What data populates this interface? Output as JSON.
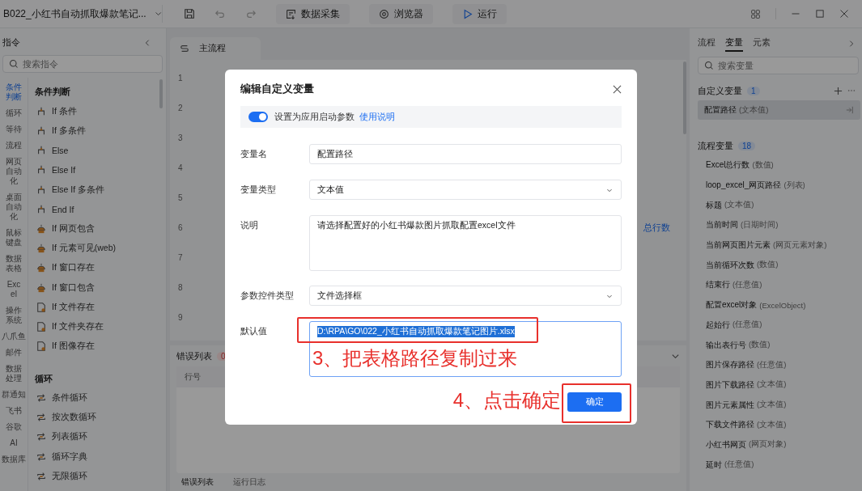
{
  "title_bar": {
    "project_name": "B022_小红书自动抓取爆款笔记...",
    "tools": [
      {
        "label": "数据采集",
        "kind": "collect"
      },
      {
        "label": "浏览器",
        "kind": "browser"
      },
      {
        "label": "运行",
        "kind": "run"
      }
    ]
  },
  "left_panel": {
    "title": "指令",
    "search_placeholder": "搜索指令",
    "categories": [
      {
        "label": "条件判断",
        "selected": true
      },
      {
        "label": "循环",
        "selected": false
      },
      {
        "label": "等待",
        "selected": false
      },
      {
        "label": "流程",
        "selected": false
      },
      {
        "label": "网页自动化",
        "selected": false
      },
      {
        "label": "桌面自动化",
        "selected": false
      },
      {
        "label": "鼠标键盘",
        "selected": false
      },
      {
        "label": "数据表格",
        "selected": false
      },
      {
        "label": "Excel",
        "selected": false
      },
      {
        "label": "操作系统",
        "selected": false
      },
      {
        "label": "八爪鱼",
        "selected": false
      },
      {
        "label": "邮件",
        "selected": false
      },
      {
        "label": "数据处理",
        "selected": false
      },
      {
        "label": "群通知",
        "selected": false
      },
      {
        "label": "飞书",
        "selected": false
      },
      {
        "label": "谷歌",
        "selected": false
      },
      {
        "label": "AI",
        "selected": false
      },
      {
        "label": "数据库",
        "selected": false
      }
    ],
    "groups": [
      {
        "title": "条件判断",
        "items": [
          {
            "label": "If 条件",
            "kind": "branch"
          },
          {
            "label": "If 多条件",
            "kind": "branch"
          },
          {
            "label": "Else",
            "kind": "branch"
          },
          {
            "label": "Else If",
            "kind": "branch"
          },
          {
            "label": "Else If 多条件",
            "kind": "branch"
          },
          {
            "label": "End If",
            "kind": "branch"
          },
          {
            "label": "If 网页包含",
            "kind": "probe"
          },
          {
            "label": "If 元素可见(web)",
            "kind": "probe"
          },
          {
            "label": "If 窗口存在",
            "kind": "probe"
          },
          {
            "label": "If 窗口包含",
            "kind": "probe"
          },
          {
            "label": "If 文件存在",
            "kind": "file"
          },
          {
            "label": "If 文件夹存在",
            "kind": "file"
          },
          {
            "label": "If 图像存在",
            "kind": "file"
          }
        ]
      },
      {
        "title": "循环",
        "items": [
          {
            "label": "条件循环",
            "kind": "loop"
          },
          {
            "label": "按次数循环",
            "kind": "loop"
          },
          {
            "label": "列表循环",
            "kind": "loop"
          },
          {
            "label": "循环字典",
            "kind": "loop"
          },
          {
            "label": "无限循环",
            "kind": "loop"
          }
        ]
      }
    ]
  },
  "editor": {
    "tab": "主流程",
    "line_numbers": [
      "1",
      "2",
      "3",
      "4",
      "5",
      "6",
      "7",
      "8",
      "9"
    ],
    "partial_text": "总行数"
  },
  "bottom_panel": {
    "title": "错误列表",
    "count": "0",
    "columns": [
      "行号"
    ],
    "tabs": [
      {
        "label": "错误列表",
        "selected": true
      },
      {
        "label": "运行日志",
        "selected": false
      }
    ]
  },
  "right_panel": {
    "tabs": [
      {
        "label": "流程",
        "selected": false
      },
      {
        "label": "变量",
        "selected": true
      },
      {
        "label": "元素",
        "selected": false
      }
    ],
    "search_placeholder": "搜索变量",
    "custom_vars": {
      "title": "自定义变量",
      "count": "1",
      "items": [
        {
          "name": "配置路径",
          "type": "(文本值)",
          "selected": true
        }
      ]
    },
    "flow_vars": {
      "title": "流程变量",
      "count": "18",
      "items": [
        {
          "name": "Excel总行数",
          "type": "(数值)"
        },
        {
          "name": "loop_excel_网页路径",
          "type": "(列表)"
        },
        {
          "name": "标题",
          "type": "(文本值)"
        },
        {
          "name": "当前时间",
          "type": "(日期时间)"
        },
        {
          "name": "当前网页图片元素",
          "type": "(网页元素对象)"
        },
        {
          "name": "当前循环次数",
          "type": "(数值)"
        },
        {
          "name": "结束行",
          "type": "(任意值)"
        },
        {
          "name": "配置excel对象",
          "type": "(ExcelObject)"
        },
        {
          "name": "起始行",
          "type": "(任意值)"
        },
        {
          "name": "输出表行号",
          "type": "(数值)"
        },
        {
          "name": "图片保存路径",
          "type": "(任意值)"
        },
        {
          "name": "图片下载路径",
          "type": "(文本值)"
        },
        {
          "name": "图片元素属性",
          "type": "(文本值)"
        },
        {
          "name": "下载文件路径",
          "type": "(文本值)"
        },
        {
          "name": "小红书网页",
          "type": "(网页对象)"
        },
        {
          "name": "延时",
          "type": "(任意值)"
        }
      ]
    }
  },
  "dialog": {
    "title": "编辑自定义变量",
    "toggle": {
      "label": "设置为应用启动参数",
      "link": "使用说明",
      "on": true
    },
    "fields": [
      {
        "label": "变量名",
        "kind": "input",
        "value": "配置路径"
      },
      {
        "label": "变量类型",
        "kind": "select",
        "value": "文本值"
      },
      {
        "label": "说明",
        "kind": "textarea",
        "value": "请选择配置好的小红书爆款图片抓取配置excel文件"
      },
      {
        "label": "参数控件类型",
        "kind": "select",
        "value": "文件选择框"
      },
      {
        "label": "默认值",
        "kind": "textarea",
        "value": "D:\\RPA\\GO\\022_小红书自动抓取爆款笔记图片.xlsx",
        "selected": true,
        "focused": true,
        "annotation": "3、把表格路径复制过来"
      }
    ],
    "confirm_button": {
      "label": "确定",
      "annotation": "4、点击确定"
    }
  }
}
